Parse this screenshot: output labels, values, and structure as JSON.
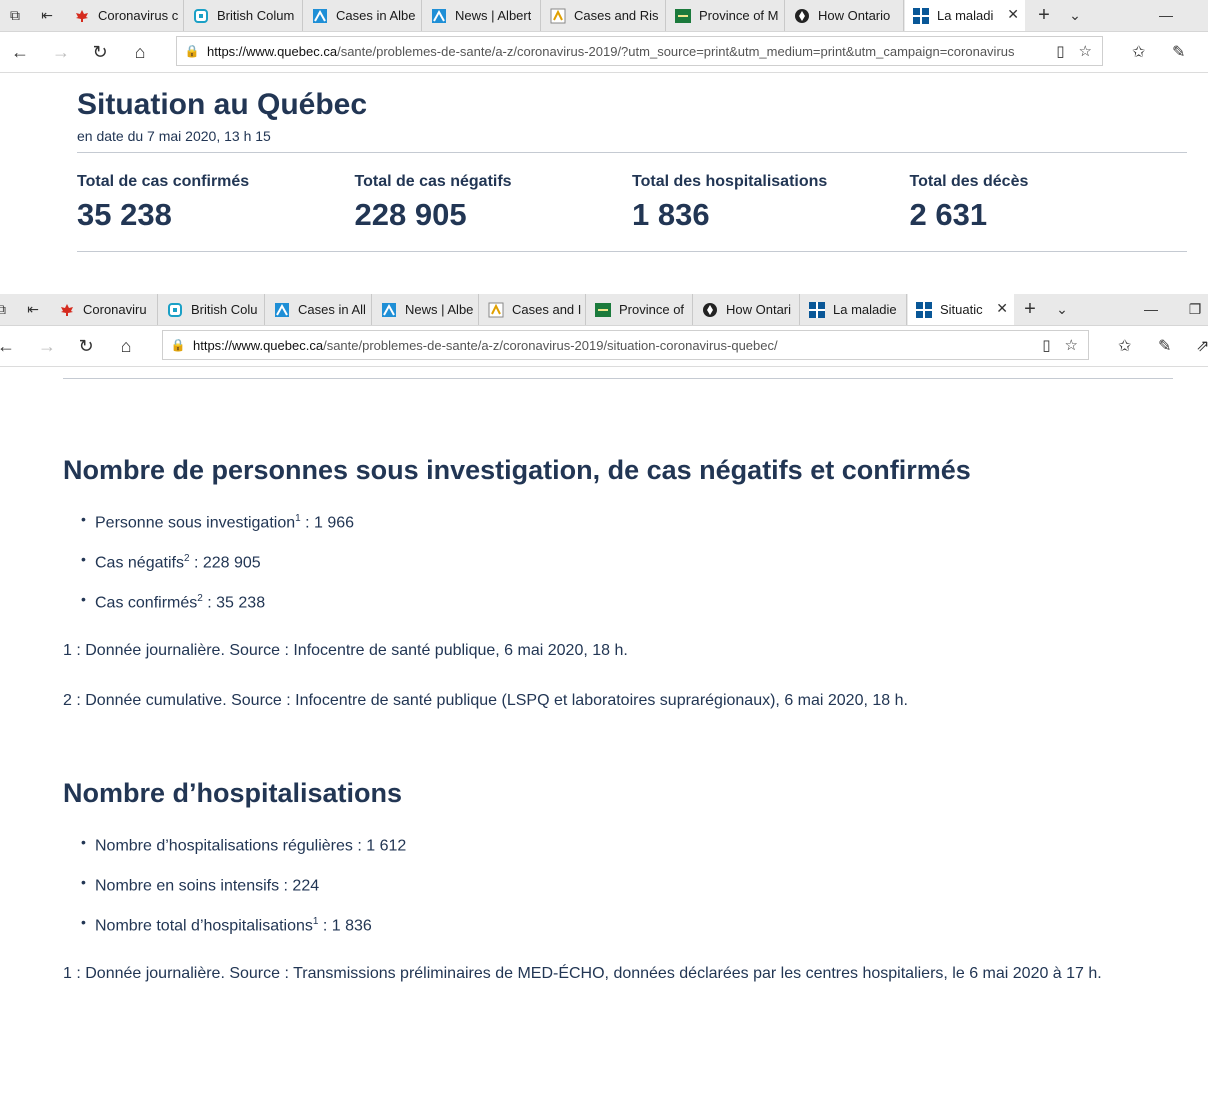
{
  "window1": {
    "tabs": [
      {
        "label": "Coronavirus c",
        "icon": "canada-flag-icon"
      },
      {
        "label": "British Colum",
        "icon": "bc-health-icon"
      },
      {
        "label": "Cases in Albe",
        "icon": "alberta-icon"
      },
      {
        "label": "News | Albert",
        "icon": "alberta-icon"
      },
      {
        "label": "Cases and Ris",
        "icon": "sask-icon"
      },
      {
        "label": "Province of M",
        "icon": "manitoba-icon"
      },
      {
        "label": "How Ontario",
        "icon": "ontario-icon"
      },
      {
        "label": "La maladi",
        "icon": "quebec-icon",
        "active": true
      }
    ],
    "url_domain": "https://www.quebec.ca",
    "url_path": "/sante/problemes-de-sante/a-z/coronavirus-2019/?utm_source=print&utm_medium=print&utm_campaign=coronavirus"
  },
  "situation": {
    "title": "Situation au Québec",
    "date": "en date du 7 mai 2020, 13 h 15",
    "stats": [
      {
        "label": "Total de cas confirmés",
        "value": "35 238"
      },
      {
        "label": "Total de cas négatifs",
        "value": "228 905"
      },
      {
        "label": "Total des hospitalisations",
        "value": "1 836"
      },
      {
        "label": "Total des décès",
        "value": "2 631"
      }
    ]
  },
  "window2": {
    "tabs": [
      {
        "label": "Coronaviru",
        "icon": "canada-flag-icon"
      },
      {
        "label": "British Colu",
        "icon": "bc-health-icon"
      },
      {
        "label": "Cases in All",
        "icon": "alberta-icon"
      },
      {
        "label": "News | Albe",
        "icon": "alberta-icon"
      },
      {
        "label": "Cases and I",
        "icon": "sask-icon"
      },
      {
        "label": "Province of",
        "icon": "manitoba-icon"
      },
      {
        "label": "How Ontari",
        "icon": "ontario-icon"
      },
      {
        "label": "La maladie",
        "icon": "quebec-icon"
      },
      {
        "label": "Situatic",
        "icon": "quebec-icon",
        "active": true
      }
    ],
    "url_domain": "https://www.quebec.ca",
    "url_path": "/sante/problemes-de-sante/a-z/coronavirus-2019/situation-coronavirus-quebec/"
  },
  "investigation": {
    "heading": "Nombre de personnes sous investigation, de cas négatifs et confirmés",
    "items": [
      {
        "label": "Personne sous investigation",
        "sup": "1",
        "value": " : 1 966"
      },
      {
        "label": "Cas négatifs",
        "sup": "2",
        "value": " : 228 905"
      },
      {
        "label": "Cas confirmés",
        "sup": "2",
        "value": " : 35 238"
      }
    ],
    "note1": "1 : Donnée journalière. Source : Infocentre de santé publique, 6 mai 2020, 18 h.",
    "note2": "2 : Donnée cumulative. Source : Infocentre de santé publique (LSPQ et laboratoires suprarégionaux), 6 mai 2020, 18 h."
  },
  "hospitalisations": {
    "heading": "Nombre d’hospitalisations",
    "items": [
      {
        "label": "Nombre d’hospitalisations régulières",
        "sup": "",
        "value": " : 1 612"
      },
      {
        "label": "Nombre en soins intensifs",
        "sup": "",
        "value": " : 224"
      },
      {
        "label": "Nombre total d’hospitalisations",
        "sup": "1",
        "value": " : 1 836"
      }
    ],
    "note1": "1 : Donnée journalière. Source : Transmissions préliminaires de MED-ÉCHO, données déclarées par les centres hospitaliers, le 6 mai 2020 à 17 h."
  }
}
